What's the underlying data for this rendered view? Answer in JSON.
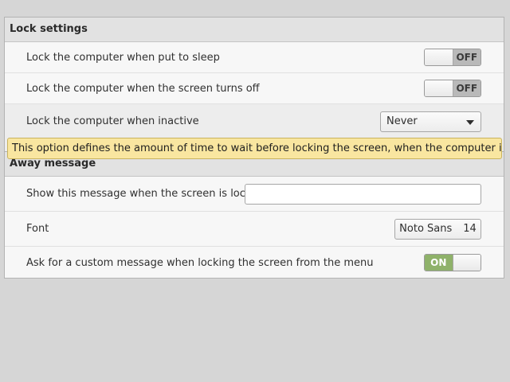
{
  "lock_settings": {
    "header": "Lock settings",
    "rows": [
      {
        "label": "Lock the computer when put to sleep",
        "switch_state": "OFF"
      },
      {
        "label": "Lock the computer when the screen turns off",
        "switch_state": "OFF"
      },
      {
        "label": "Lock the computer when inactive",
        "dropdown_value": "Never"
      }
    ]
  },
  "tooltip": {
    "text": "This option defines the amount of time to wait before locking the screen, when the computer is not being used"
  },
  "away_message": {
    "header": "Away message",
    "rows": [
      {
        "label": "Show this message when the screen is locked",
        "input_value": ""
      },
      {
        "label": "Font",
        "font_name": "Noto Sans",
        "font_size": "14"
      },
      {
        "label": "Ask for a custom message when locking the screen from the menu",
        "switch_state": "ON"
      }
    ]
  },
  "colors": {
    "switch_on": "#8fb26a",
    "switch_off": "#b9b9b9",
    "tooltip_bg": "#f9e6a0"
  }
}
